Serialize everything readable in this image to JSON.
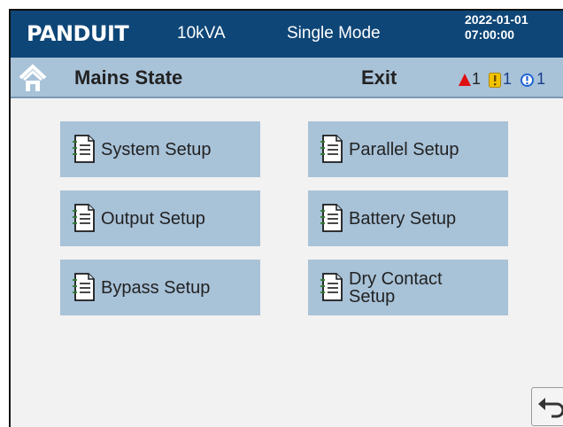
{
  "header": {
    "brand": "PANDUIT",
    "capacity": "10kVA",
    "mode": "Single Mode",
    "date": "2022-01-01",
    "time": "07:00:00"
  },
  "subbar": {
    "state_label": "Mains State",
    "exit_label": "Exit",
    "alarms": {
      "critical_count": "1",
      "warning_count": "1",
      "info_count": "1"
    }
  },
  "menu": [
    {
      "label": "System Setup",
      "icon": "document-icon"
    },
    {
      "label": "Parallel Setup",
      "icon": "document-icon"
    },
    {
      "label": "Output Setup",
      "icon": "document-icon"
    },
    {
      "label": "Battery Setup",
      "icon": "document-icon"
    },
    {
      "label": "Bypass Setup",
      "icon": "document-icon"
    },
    {
      "label": "Dry Contact Setup",
      "icon": "document-icon"
    }
  ],
  "colors": {
    "header_bg": "#0e4677",
    "subbar_bg": "#a8c2d8",
    "tile_bg": "#a8c2d8",
    "alarm_red": "#e01010",
    "warning_yellow": "#f2c200",
    "info_blue": "#1f64d6"
  }
}
